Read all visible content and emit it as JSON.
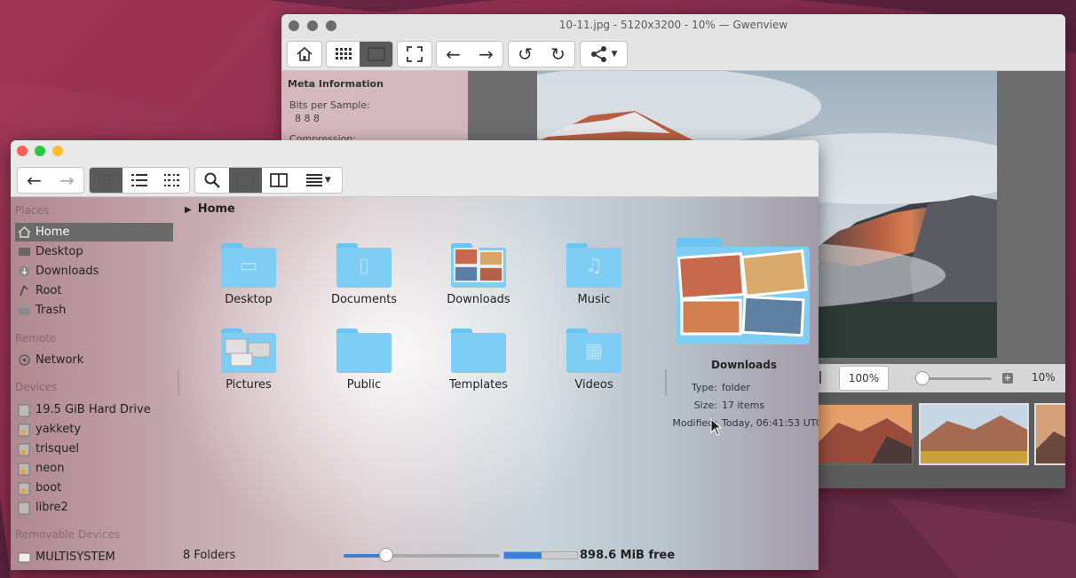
{
  "gwenview": {
    "title": "10-11.jpg - 5120x3200 - 10% — Gwenview",
    "meta": {
      "heading": "Meta Information",
      "bits_label": "Bits per Sample:",
      "bits_value": "8 8 8",
      "compression_label": "Compression:"
    },
    "zoom_fit_value": "100%",
    "zoom_level": "10%",
    "zoom_slider_fraction": 0.05
  },
  "dolphin": {
    "places": {
      "sections": {
        "places": "Places",
        "remote": "Remote",
        "devices": "Devices",
        "removable": "Removable Devices"
      },
      "items": [
        {
          "label": "Home"
        },
        {
          "label": "Desktop"
        },
        {
          "label": "Downloads"
        },
        {
          "label": "Root"
        },
        {
          "label": "Trash"
        }
      ],
      "remote_items": [
        {
          "label": "Network"
        }
      ],
      "device_items": [
        {
          "label": "19.5 GiB Hard Drive"
        },
        {
          "label": "yakkety"
        },
        {
          "label": "trisquel"
        },
        {
          "label": "neon"
        },
        {
          "label": "boot"
        },
        {
          "label": "libre2"
        }
      ],
      "removable_items": [
        {
          "label": "MULTISYSTEM"
        }
      ]
    },
    "breadcrumb": "Home",
    "folders": [
      {
        "label": "Desktop"
      },
      {
        "label": "Documents"
      },
      {
        "label": "Downloads"
      },
      {
        "label": "Music"
      },
      {
        "label": "Pictures"
      },
      {
        "label": "Public"
      },
      {
        "label": "Templates"
      },
      {
        "label": "Videos"
      }
    ],
    "info_panel": {
      "name": "Downloads",
      "type_label": "Type:",
      "type_value": "folder",
      "size_label": "Size:",
      "size_value": "17 items",
      "modified_label": "Modified:",
      "modified_value": "Today, 06:41:53 UTC"
    },
    "status": {
      "count": "8 Folders",
      "free_space": "898.6 MiB free",
      "zoom_slider_fraction": 0.27,
      "disk_free_fraction": 0.51
    }
  },
  "colors": {
    "close": "#ff5f57",
    "minimize": "#ffbd2e",
    "maximize": "#28c940",
    "folder_blue": "#7dcdf5",
    "accent": "#3d7fd6"
  }
}
